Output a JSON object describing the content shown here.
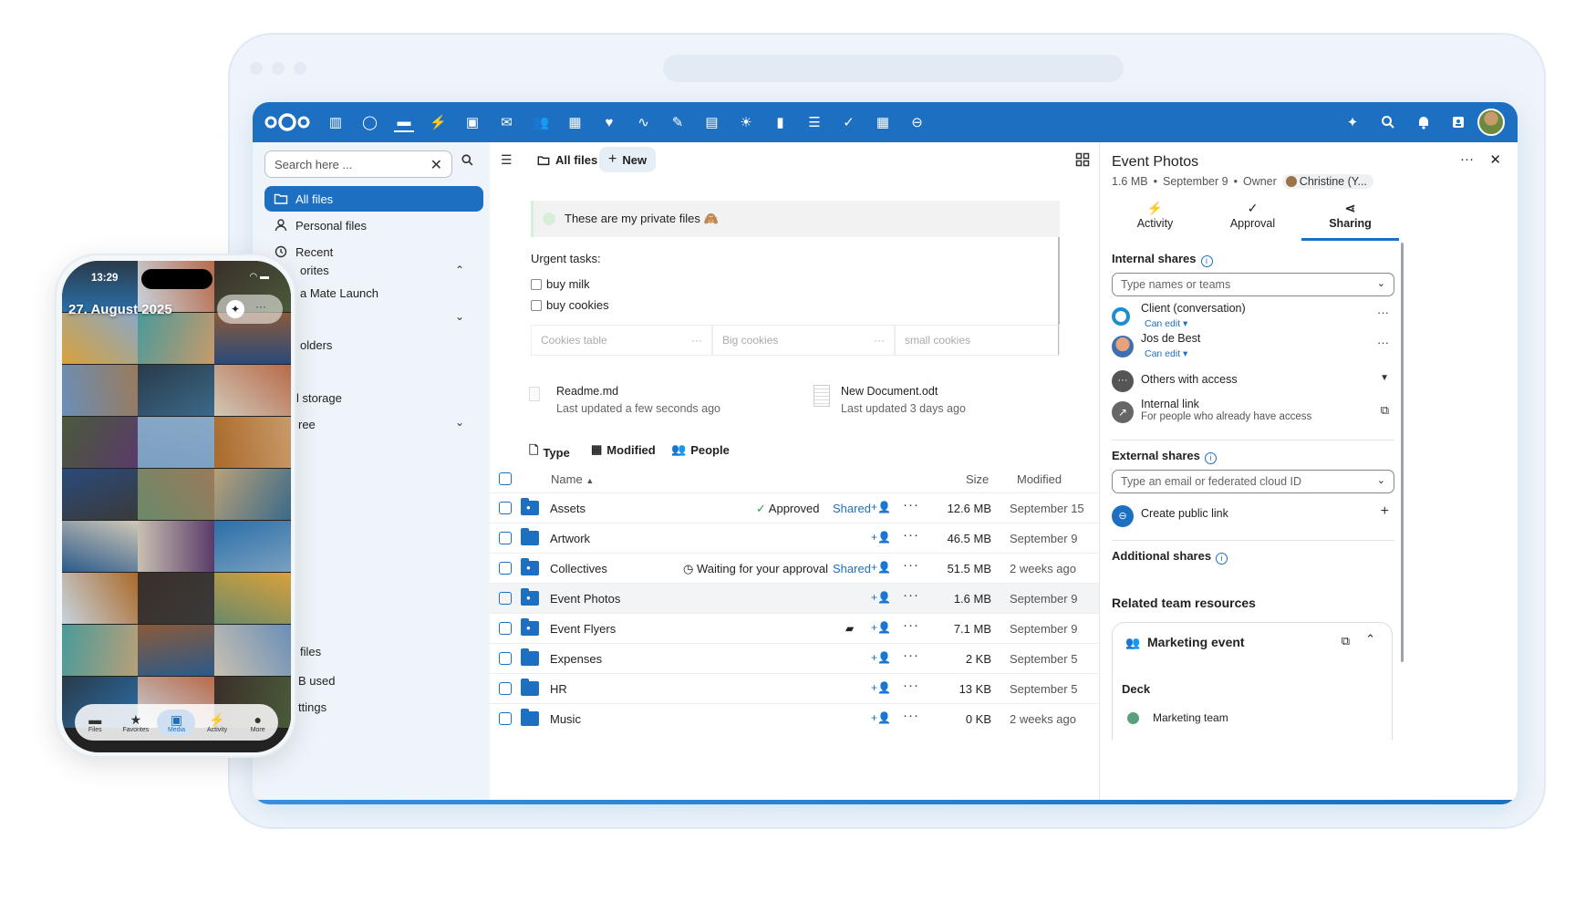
{
  "window": {
    "browser_url_placeholder": ""
  },
  "topbar": {
    "apps": [
      "dashboard-icon",
      "talk-icon",
      "files-icon",
      "activity-icon",
      "photos-icon",
      "mail-icon",
      "contacts-icon",
      "calendar-icon",
      "health-icon",
      "analytics-icon",
      "notes-icon",
      "deck-icon",
      "weather-icon",
      "charts-icon",
      "list-icon",
      "tasks-icon",
      "tables-icon",
      "forms-icon"
    ],
    "right": [
      "assistant-icon",
      "search-icon",
      "notifications-icon",
      "contacts-menu-icon"
    ]
  },
  "nav": {
    "search_placeholder": "Search here ...",
    "items": [
      {
        "label": "All files",
        "icon": "folder-icon",
        "active": true
      },
      {
        "label": "Personal files",
        "icon": "person-icon"
      },
      {
        "label": "Recent",
        "icon": "history-icon"
      }
    ],
    "fragments": [
      "orites",
      "a Mate Launch",
      "olders",
      "l storage",
      "ree",
      "files",
      "B used",
      "ttings"
    ]
  },
  "main": {
    "breadcrumb": "All files",
    "new_label": "New",
    "note_text": "These are my private files 🙈",
    "urgent_heading": "Urgent tasks:",
    "tasks": [
      "buy milk",
      "buy cookies"
    ],
    "table_cells": [
      "Cookies table",
      "Big cookies",
      "small cookies"
    ],
    "recent": [
      {
        "name": "Readme.md",
        "updated": "Last updated a few seconds ago"
      },
      {
        "name": "New Document.odt",
        "updated": "Last updated 3 days ago"
      }
    ],
    "filters": [
      "Type",
      "Modified",
      "People"
    ],
    "headers": {
      "name": "Name",
      "size": "Size",
      "modified": "Modified"
    },
    "files": [
      {
        "name": "Assets",
        "status": "Approved",
        "shared": "Shared",
        "size": "12.6 MB",
        "modified": "September 15",
        "shared_folder": true
      },
      {
        "name": "Artwork",
        "status": "",
        "shared": "",
        "size": "46.5 MB",
        "modified": "September 9",
        "shared_folder": false
      },
      {
        "name": "Collectives",
        "status": "Waiting for your approval",
        "shared": "Shared",
        "size": "51.5 MB",
        "modified": "2 weeks ago",
        "shared_folder": true
      },
      {
        "name": "Event Photos",
        "status": "",
        "shared": "",
        "size": "1.6 MB",
        "modified": "September 9",
        "shared_folder": true,
        "highlight": true
      },
      {
        "name": "Event Flyers",
        "status": "",
        "shared": "",
        "size": "7.1 MB",
        "modified": "September 9",
        "shared_folder": true,
        "comment": true
      },
      {
        "name": "Expenses",
        "status": "",
        "shared": "",
        "size": "2 KB",
        "modified": "September 5",
        "shared_folder": false
      },
      {
        "name": "HR",
        "status": "",
        "shared": "",
        "size": "13 KB",
        "modified": "September 5",
        "shared_folder": false
      },
      {
        "name": "Music",
        "status": "",
        "shared": "",
        "size": "0 KB",
        "modified": "2 weeks ago",
        "shared_folder": false
      }
    ]
  },
  "sidebar": {
    "title": "Event Photos",
    "size": "1.6 MB",
    "date": "September 9",
    "owner_label": "Owner",
    "owner_name": "Christine (Y...",
    "tabs": [
      {
        "label": "Activity",
        "icon": "⚡"
      },
      {
        "label": "Approval",
        "icon": "✓"
      },
      {
        "label": "Sharing",
        "icon": "⋖"
      }
    ],
    "internal_shares": "Internal shares",
    "internal_placeholder": "Type names or teams",
    "shares": [
      {
        "name": "Client (conversation)",
        "perm": "Can edit"
      },
      {
        "name": "Jos de Best",
        "perm": "Can edit"
      }
    ],
    "others_access": "Others with access",
    "internal_link": "Internal link",
    "internal_link_sub": "For people who already have access",
    "external_shares": "External shares",
    "external_placeholder": "Type an email or federated cloud ID",
    "create_public_link": "Create public link",
    "additional_shares": "Additional shares",
    "related": "Related team resources",
    "team_name": "Marketing event",
    "deck_label": "Deck",
    "deck_item": "Marketing team"
  },
  "phone": {
    "time": "13:29",
    "date": "27. August 2025",
    "tabs": [
      {
        "label": "Files",
        "icon": "▬"
      },
      {
        "label": "Favorites",
        "icon": "★"
      },
      {
        "label": "Media",
        "icon": "▣"
      },
      {
        "label": "Activity",
        "icon": "⚡"
      },
      {
        "label": "More",
        "icon": "●"
      }
    ]
  },
  "colors": {
    "accent": "#1c6fc1",
    "nav_bg": "#eef4fa",
    "approved": "#2d9a4a"
  }
}
